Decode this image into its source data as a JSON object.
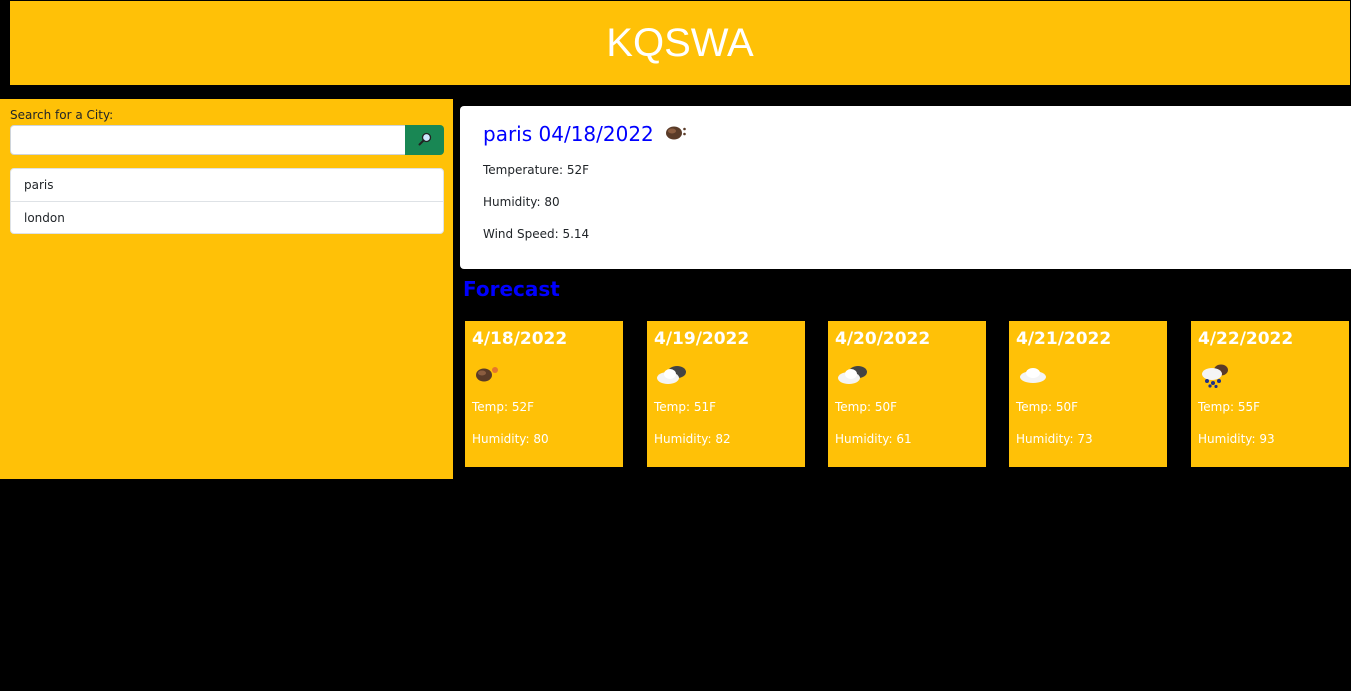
{
  "header": {
    "title": "KQSWA"
  },
  "search": {
    "label": "Search for a City:",
    "value": "",
    "placeholder": "",
    "button_icon": "search-icon"
  },
  "history": [
    "paris",
    "london"
  ],
  "current": {
    "title": "paris 04/18/2022",
    "icon": "cloudy-icon",
    "temperature": "Temperature: 52F",
    "humidity": "Humidity: 80",
    "wind": "Wind Speed: 5.14"
  },
  "forecast_title": "Forecast",
  "forecast": [
    {
      "date": "4/18/2022",
      "icon": "overcast-icon",
      "temp": "Temp: 52F",
      "humidity": "Humidity: 80"
    },
    {
      "date": "4/19/2022",
      "icon": "broken-clouds-icon",
      "temp": "Temp: 51F",
      "humidity": "Humidity: 82"
    },
    {
      "date": "4/20/2022",
      "icon": "broken-clouds-icon",
      "temp": "Temp: 50F",
      "humidity": "Humidity: 61"
    },
    {
      "date": "4/21/2022",
      "icon": "few-clouds-icon",
      "temp": "Temp: 50F",
      "humidity": "Humidity: 73"
    },
    {
      "date": "4/22/2022",
      "icon": "rain-icon",
      "temp": "Temp: 55F",
      "humidity": "Humidity: 93"
    }
  ],
  "colors": {
    "accent": "#ffc107",
    "title_blue": "#0000ff",
    "search_button": "#198754"
  }
}
